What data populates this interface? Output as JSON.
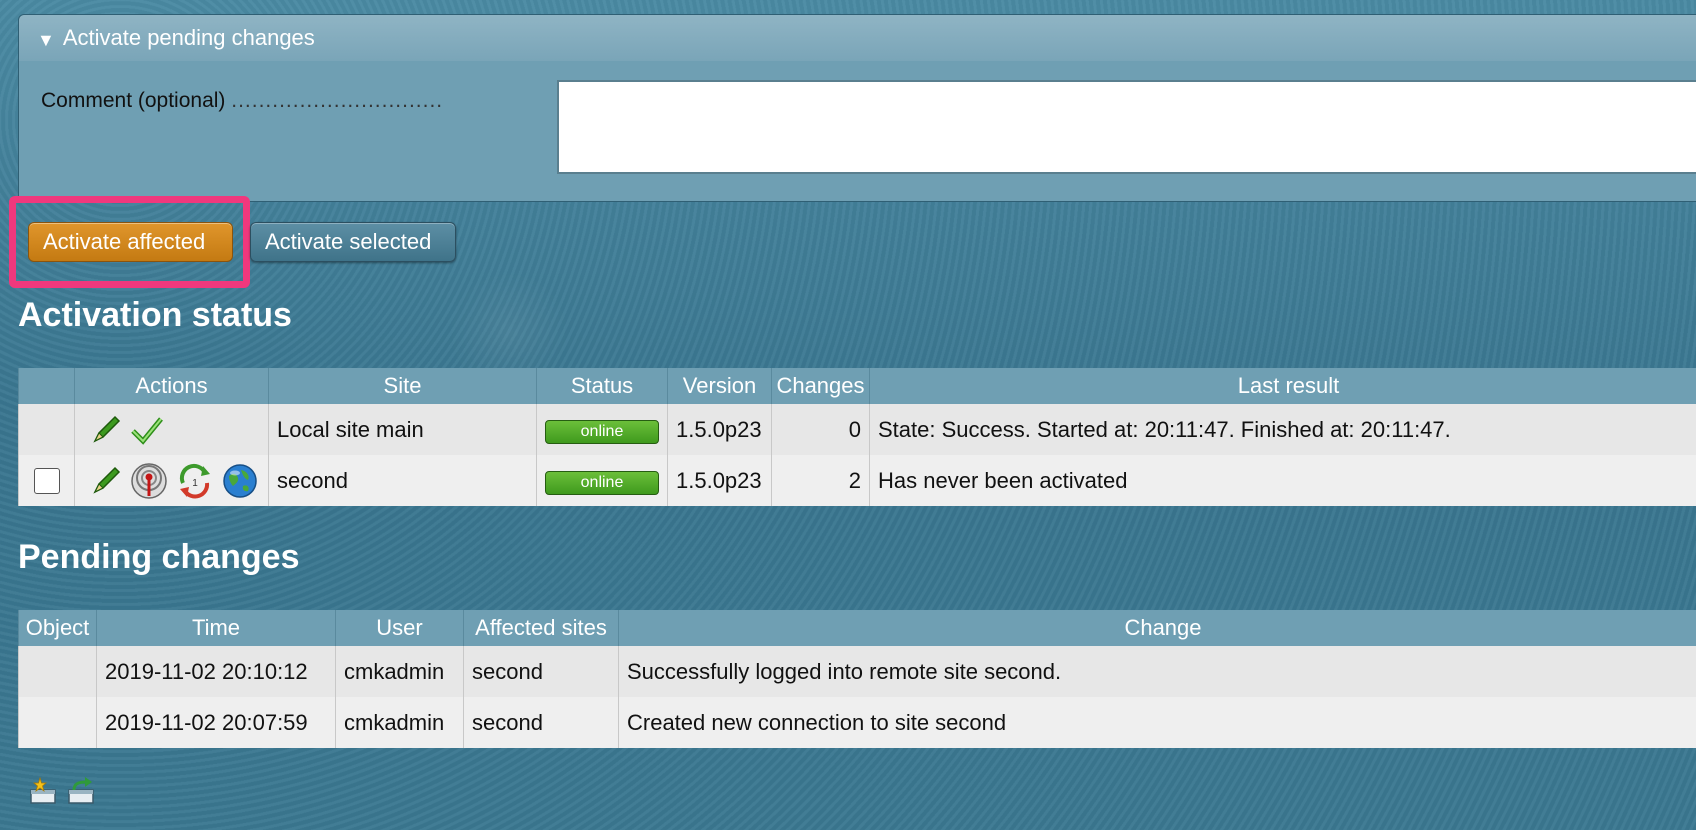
{
  "panel": {
    "title": "Activate pending changes",
    "comment_label": "Comment (optional)",
    "comment_dots": "...............................",
    "comment_value": ""
  },
  "buttons": {
    "affected": "Activate affected",
    "selected": "Activate selected"
  },
  "activation": {
    "heading": "Activation status",
    "columns": [
      "",
      "Actions",
      "Site",
      "Status",
      "Version",
      "Changes",
      "Last result"
    ],
    "rows": [
      {
        "site": "Local site main",
        "status": "online",
        "version": "1.5.0p23",
        "changes": "0",
        "last_result": "State: Success. Started at: 20:11:47. Finished at: 20:11:47.",
        "icons": [
          "edit-icon",
          "check-icon"
        ]
      },
      {
        "site": "second",
        "status": "online",
        "version": "1.5.0p23",
        "changes": "2",
        "last_result": "Has never been activated",
        "icons": [
          "edit-icon",
          "antenna-icon",
          "sync-icon",
          "globe-icon"
        ]
      }
    ]
  },
  "pending": {
    "heading": "Pending changes",
    "columns": [
      "Object",
      "Time",
      "User",
      "Affected sites",
      "Change"
    ],
    "rows": [
      {
        "object": "",
        "time": "2019-11-02 20:10:12",
        "user": "cmkadmin",
        "sites": "second",
        "change": "Successfully logged into remote site second."
      },
      {
        "object": "",
        "time": "2019-11-02 20:07:59",
        "user": "cmkadmin",
        "sites": "second",
        "change": "Created new connection to site second"
      }
    ]
  },
  "colors": {
    "accent_button": "#d48a1f",
    "highlight": "#f0387d",
    "online": "#4fa82a",
    "header_bg": "#6f9fb3"
  }
}
